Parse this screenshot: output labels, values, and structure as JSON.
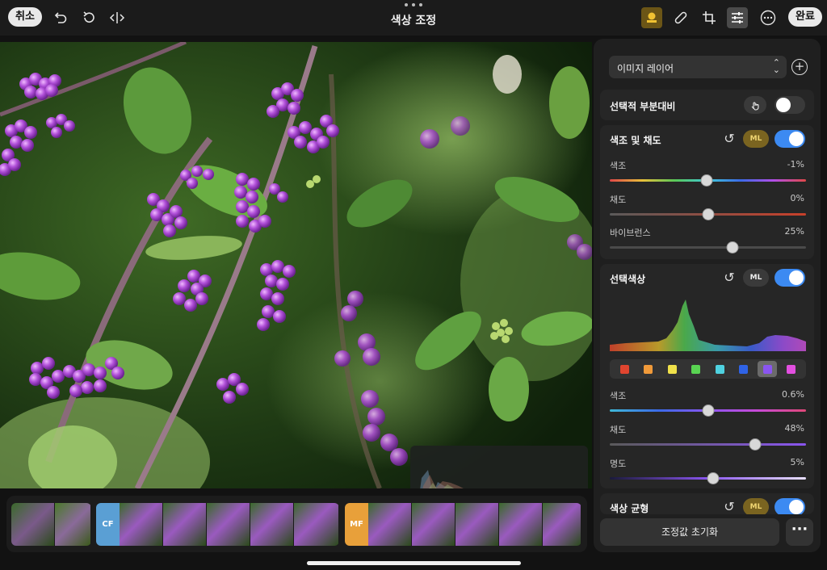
{
  "header": {
    "cancel_label": "취소",
    "title": "색상 조정",
    "done_label": "완료",
    "accent": "#f1c232"
  },
  "layer": {
    "select_label": "이미지 레이어"
  },
  "selective_contrast": {
    "title": "선택적 부분대비",
    "enabled": false
  },
  "hue_saturation": {
    "title": "색조 및 채도",
    "ml_label": "ML",
    "enabled": true,
    "sliders": [
      {
        "label": "색조",
        "value": "-1%",
        "level": -0.01
      },
      {
        "label": "채도",
        "value": "0%",
        "level": 0.0
      },
      {
        "label": "바이브런스",
        "value": "25%",
        "level": 0.25
      }
    ]
  },
  "selective_color": {
    "title": "선택색상",
    "ml_label": "ML",
    "enabled": true,
    "swatches": [
      "#e0452f",
      "#f09a3a",
      "#f0e14a",
      "#59d452",
      "#4fd2e0",
      "#2f63e6",
      "#8a55f0",
      "#e34fe0"
    ],
    "selected_swatch": 6,
    "sliders": [
      {
        "label": "색조",
        "value": "0.6%",
        "level": 0.006
      },
      {
        "label": "채도",
        "value": "48%",
        "level": 0.48
      },
      {
        "label": "명도",
        "value": "5%",
        "level": 0.05
      }
    ]
  },
  "color_balance": {
    "title": "색상 균형",
    "ml_label": "ML",
    "enabled": true
  },
  "footer": {
    "reset_label": "조정값 초기화",
    "more_label": "···"
  },
  "filmstrip": {
    "cf_label": "CF",
    "mf_label": "MF",
    "cf_color": "#5a9fd4",
    "mf_color": "#e8a03a"
  }
}
